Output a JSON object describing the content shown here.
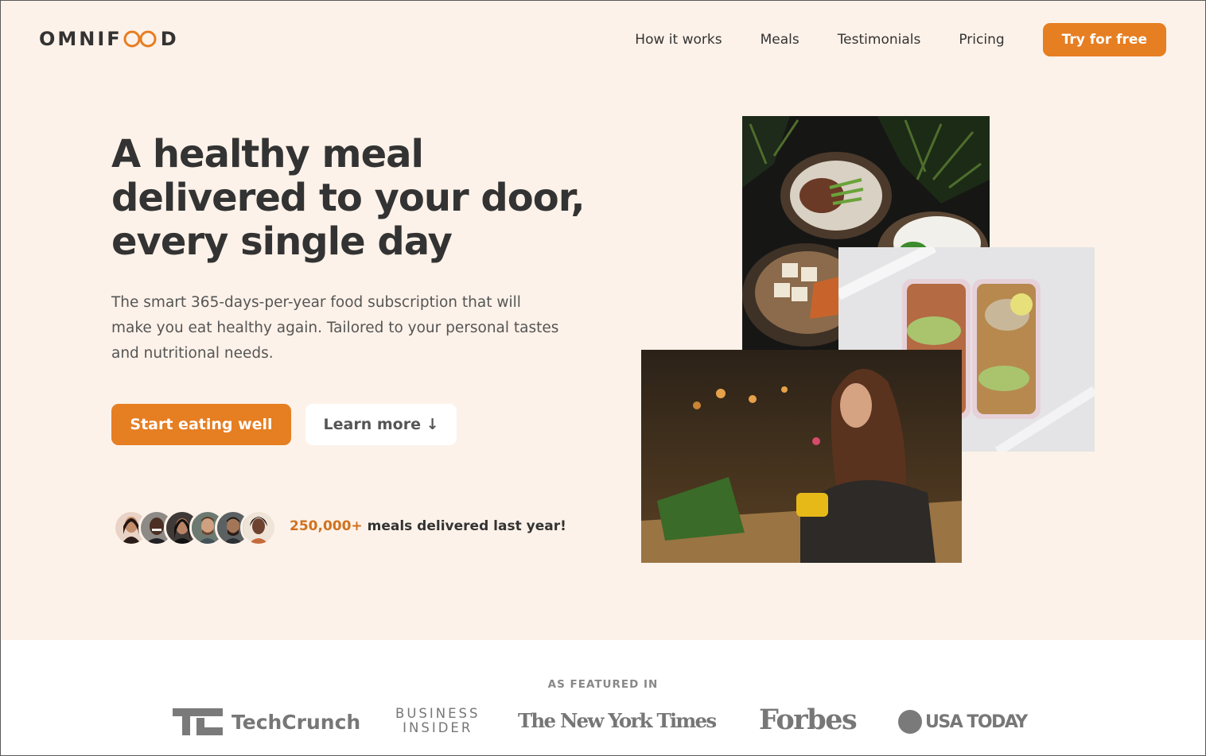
{
  "brand": {
    "name_before": "OMNIF",
    "name_after": "D",
    "accent": "#e67e22"
  },
  "nav": {
    "items": [
      "How it works",
      "Meals",
      "Testimonials",
      "Pricing"
    ],
    "cta": "Try for free"
  },
  "hero": {
    "title_line1": "A healthy meal",
    "title_line2": "delivered to your door,",
    "title_line3": "every single day",
    "description": "The smart 365-days-per-year food subscription that will make you eat healthy again. Tailored to your personal tastes and nutritional needs.",
    "primary_button": "Start eating well",
    "secondary_button": "Learn more ↓",
    "delivered_count": "250,000+",
    "delivered_text": " meals delivered last year!"
  },
  "featured": {
    "title": "AS FEATURED IN",
    "logos": {
      "techcrunch": "TechCrunch",
      "business_insider_line1": "BUSINESS",
      "business_insider_line2": "INSIDER",
      "nyt": "The New York Times",
      "forbes": "Forbes",
      "usatoday": "USA TODAY"
    }
  },
  "colors": {
    "background": "#fdf2e9",
    "primary": "#e67e22",
    "text": "#333333"
  }
}
